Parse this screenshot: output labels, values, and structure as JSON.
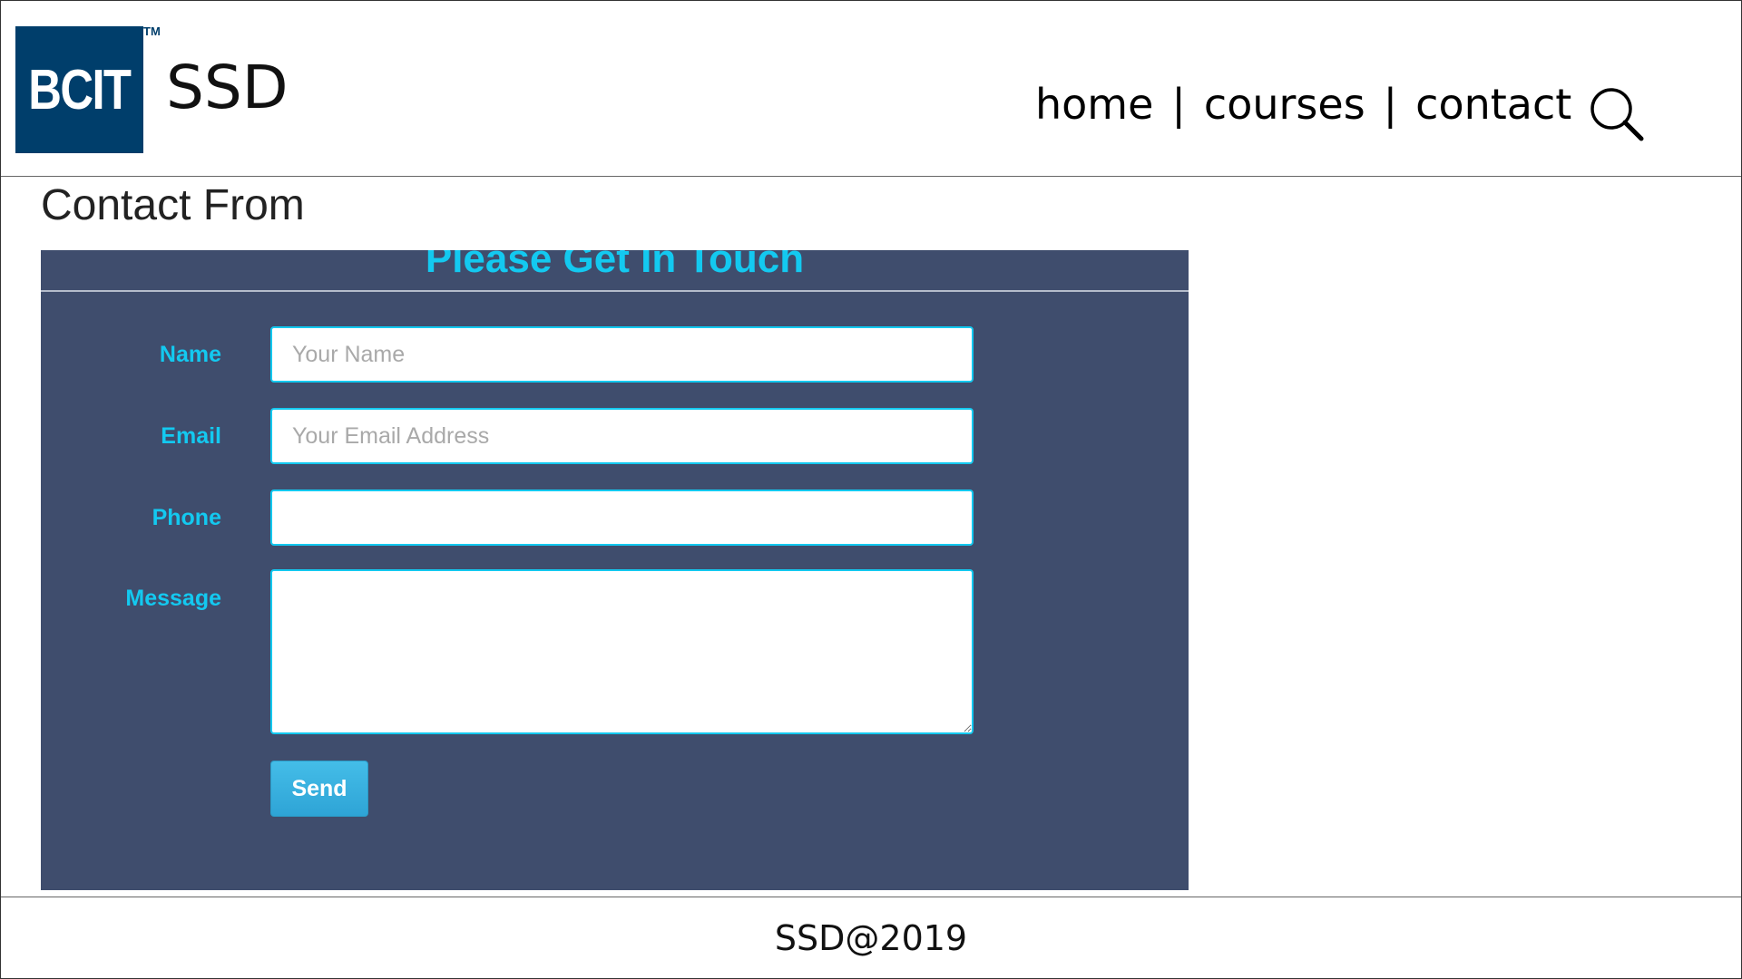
{
  "header": {
    "logo_text": "BCIT",
    "logo_tm": "TM",
    "site_title": "SSD",
    "nav": {
      "home": "home",
      "courses": "courses",
      "contact": "contact",
      "separator": "|"
    },
    "search_icon": "search-icon"
  },
  "main": {
    "page_title": "Contact From",
    "form": {
      "heading": "Please Get In Touch",
      "fields": {
        "name": {
          "label": "Name",
          "placeholder": "Your Name",
          "value": ""
        },
        "email": {
          "label": "Email",
          "placeholder": "Your Email Address",
          "value": ""
        },
        "phone": {
          "label": "Phone",
          "placeholder": "",
          "value": ""
        },
        "message": {
          "label": "Message",
          "placeholder": "",
          "value": ""
        }
      },
      "send_label": "Send"
    }
  },
  "footer": {
    "text": "SSD@2019"
  },
  "colors": {
    "logo_bg": "#003e6b",
    "form_bg": "#3f4d6d",
    "accent": "#13c9f0",
    "button": "#2ea4d6"
  }
}
